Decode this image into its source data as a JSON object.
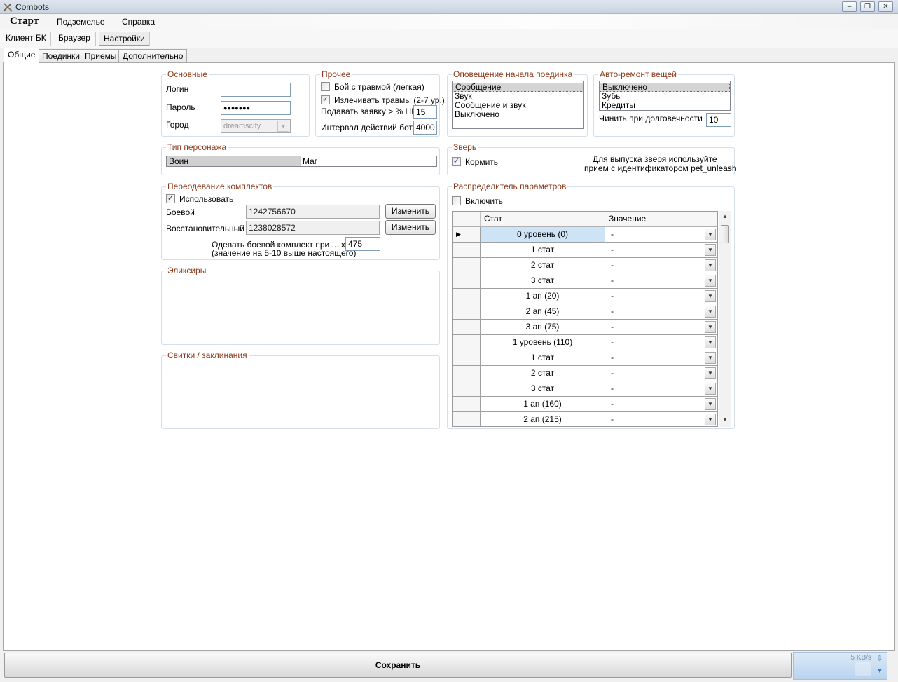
{
  "window": {
    "title": "Combots",
    "minimize": "‒",
    "maximize": "❐",
    "close": "✕"
  },
  "menu": {
    "start": "Старт",
    "dungeon": "Подземелье",
    "help": "Справка"
  },
  "toolbar": {
    "client": "Клиент БК",
    "browser": "Браузер",
    "settings": "Настройки"
  },
  "tabs": [
    "Общие",
    "Поединки",
    "Приемы",
    "Дополнительно"
  ],
  "basic": {
    "title": "Основные",
    "login_label": "Логин",
    "login_value": "",
    "password_label": "Пароль",
    "password_value": "●●●●●●●",
    "city_label": "Город",
    "city_value": "dreamscity"
  },
  "other": {
    "title": "Прочее",
    "trauma_fight_label": "Бой с травмой (легкая)",
    "trauma_fight_checked": false,
    "heal_trauma_label": "Излечивать травмы (2-7 ур.)",
    "heal_trauma_checked": true,
    "request_hp_label": "Подавать заявку > % HP",
    "request_hp_value": "15",
    "interval_label": "Интервал действий бота",
    "interval_value": "4000"
  },
  "notify": {
    "title": "Оповещение начала поединка",
    "items": [
      "Сообщение",
      "Звук",
      "Сообщение и звук",
      "Выключено"
    ],
    "selected": 0
  },
  "repair": {
    "title": "Авто-ремонт вещей",
    "items": [
      "Выключено",
      "Зубы",
      "Кредиты"
    ],
    "selected": 0,
    "durability_label": "Чинить при долговечности",
    "durability_value": "10"
  },
  "char_type": {
    "title": "Тип персонажа",
    "warrior": "Воин",
    "mage": "Маг"
  },
  "pet": {
    "title": "Зверь",
    "feed_label": "Кормить",
    "feed_checked": true,
    "hint_line1": "Для выпуска зверя используйте",
    "hint_line2": "прием с идентификатором pet_unleash"
  },
  "sets": {
    "title": "Переодевание комплектов",
    "use_label": "Использовать",
    "use_checked": true,
    "combat_label": "Боевой",
    "combat_value": "1242756670",
    "restore_label": "Восстановительный",
    "restore_value": "1238028572",
    "change_label": "Изменить",
    "hp_label_line1": "Одевать боевой комплект при ... хп",
    "hp_label_line2": "(значение на 5-10 выше настоящего)",
    "hp_value": "475"
  },
  "elixirs": {
    "title": "Эликсиры"
  },
  "scrolls": {
    "title": "Свитки / заклинания"
  },
  "distributor": {
    "title": "Распределитель параметров",
    "enable_label": "Включить",
    "enable_checked": false,
    "col_stat": "Стат",
    "col_value": "Значение",
    "rows": [
      {
        "stat": "0 уровень (0)",
        "value": "-"
      },
      {
        "stat": "1 стат",
        "value": "-"
      },
      {
        "stat": "2 стат",
        "value": "-"
      },
      {
        "stat": "3 стат",
        "value": "-"
      },
      {
        "stat": "1 ап (20)",
        "value": "-"
      },
      {
        "stat": "2 ап (45)",
        "value": "-"
      },
      {
        "stat": "3 ап (75)",
        "value": "-"
      },
      {
        "stat": "1 уровень (110)",
        "value": "-"
      },
      {
        "stat": "1 стат",
        "value": "-"
      },
      {
        "stat": "2 стат",
        "value": "-"
      },
      {
        "stat": "3 стат",
        "value": "-"
      },
      {
        "stat": "1 ап (160)",
        "value": "-"
      },
      {
        "stat": "2 ап (215)",
        "value": "-"
      }
    ]
  },
  "footer": {
    "save_label": "Сохранить",
    "speed": "5 KB/s"
  }
}
